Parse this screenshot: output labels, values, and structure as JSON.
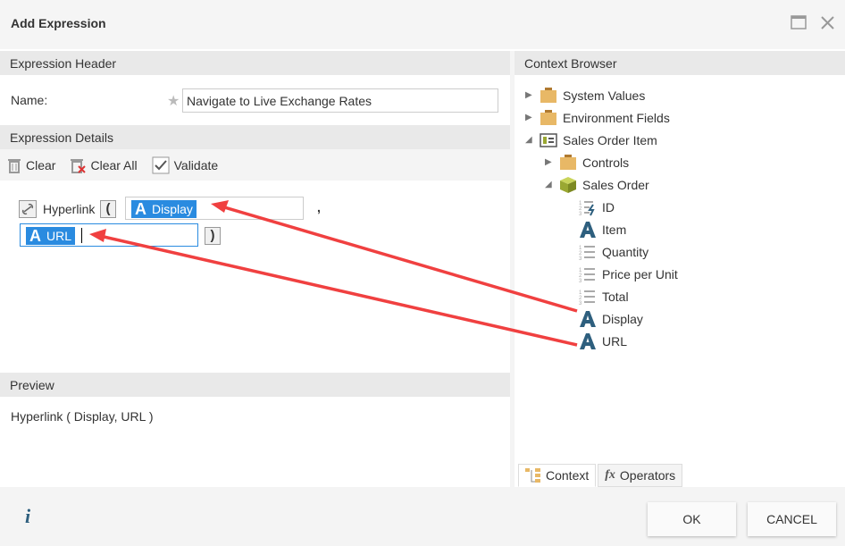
{
  "dialog": {
    "title": "Add Expression"
  },
  "header": {
    "section": "Expression Header",
    "name_label": "Name:",
    "name_value": "Navigate to Live Exchange Rates"
  },
  "details": {
    "section": "Expression Details",
    "clear": "Clear",
    "clear_all": "Clear All",
    "validate": "Validate"
  },
  "expression": {
    "function": "Hyperlink",
    "arg1": "Display",
    "comma": ",",
    "arg2": "URL"
  },
  "preview": {
    "section": "Preview",
    "text": "Hyperlink ( Display, URL )"
  },
  "context": {
    "section": "Context Browser",
    "items": [
      {
        "label": "System Values",
        "icon": "folder"
      },
      {
        "label": "Environment Fields",
        "icon": "folder"
      },
      {
        "label": "Sales Order Item",
        "icon": "form"
      },
      {
        "label": "Controls",
        "icon": "folder"
      },
      {
        "label": "Sales Order",
        "icon": "smartobject"
      },
      {
        "label": "ID",
        "icon": "autonumber"
      },
      {
        "label": "Item",
        "icon": "text"
      },
      {
        "label": "Quantity",
        "icon": "number"
      },
      {
        "label": "Price per Unit",
        "icon": "number"
      },
      {
        "label": "Total",
        "icon": "number"
      },
      {
        "label": "Display",
        "icon": "text"
      },
      {
        "label": "URL",
        "icon": "text"
      }
    ],
    "tabs": [
      "Context",
      "Operators"
    ]
  },
  "footer": {
    "ok": "OK",
    "cancel": "CANCEL"
  },
  "colors": {
    "accent": "#2a8be0",
    "annotation": "#f04040",
    "text_icon": "#2e5f7e",
    "folder": "#e8b866"
  }
}
